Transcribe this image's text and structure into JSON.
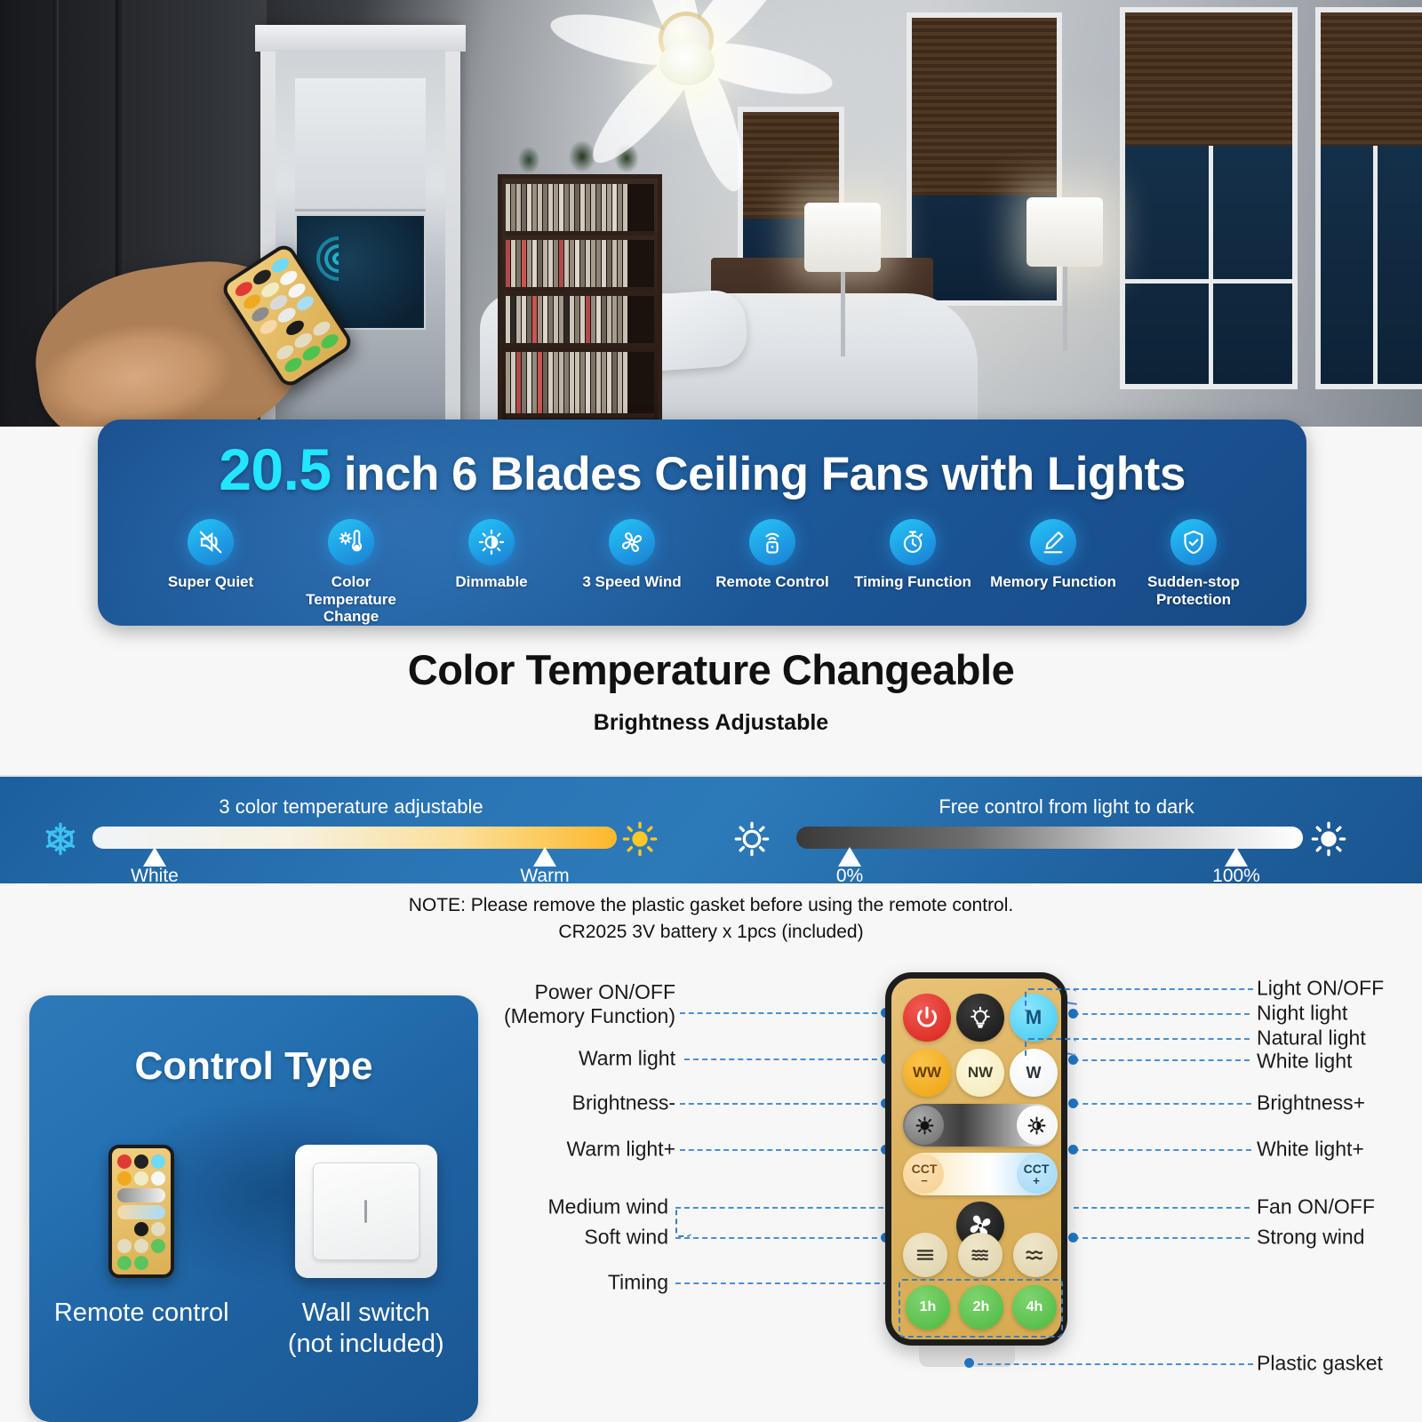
{
  "hero": {
    "alt": "bedroom-with-ceiling-fan-and-hand-holding-remote"
  },
  "banner": {
    "number": "20.5",
    "title_rest": "inch 6 Blades Ceiling Fans with Lights",
    "features": [
      {
        "label": "Super Quiet",
        "icon": "mute-speaker-icon"
      },
      {
        "label": "Color Temperature Change",
        "icon": "thermometer-sun-icon"
      },
      {
        "label": "Dimmable",
        "icon": "half-sun-icon"
      },
      {
        "label": "3 Speed Wind",
        "icon": "fan-blades-icon"
      },
      {
        "label": "Remote Control",
        "icon": "remote-signal-icon"
      },
      {
        "label": "Timing Function",
        "icon": "stopwatch-icon"
      },
      {
        "label": "Memory Function",
        "icon": "pencil-underline-icon"
      },
      {
        "label": "Sudden-stop Protection",
        "icon": "shield-check-icon"
      }
    ],
    "accent_cyan": "#22e6ff",
    "bg_blue": "#1c5697"
  },
  "mid": {
    "title": "Color Temperature Changeable",
    "subtitle": "Brightness Adjustable"
  },
  "sliders": [
    {
      "caption": "3 color temperature adjustable",
      "left_icon": "snowflake-icon",
      "right_icon": "sun-filled-icon",
      "markers": [
        {
          "label": "White",
          "pos_pct": 18
        },
        {
          "label": "Warm",
          "pos_pct": 86
        }
      ]
    },
    {
      "caption": "Free control from light to dark",
      "left_icon": "sun-outline-icon",
      "right_icon": "sun-white-icon",
      "markers": [
        {
          "label": "0%",
          "pos_pct": 19
        },
        {
          "label": "100%",
          "pos_pct": 88
        }
      ]
    }
  ],
  "note": {
    "line1": "NOTE: Please remove the plastic gasket before using the remote control.",
    "line2": "CR2025 3V battery x 1pcs (included)"
  },
  "control_type": {
    "title": "Control Type",
    "items": [
      {
        "name": "Remote control",
        "icon": "remote-control-icon"
      },
      {
        "name": "Wall switch\n(not included)",
        "icon": "wall-switch-icon"
      }
    ]
  },
  "remote": {
    "buttons": {
      "power": "",
      "light": "",
      "memory": "M",
      "warm_white": "WW",
      "natural_white": "NW",
      "white": "W",
      "brightness_down": "",
      "brightness_up": "",
      "cct_minus_top": "CCT",
      "cct_minus_sign": "−",
      "cct_plus_top": "CCT",
      "cct_plus_sign": "+",
      "fan": "",
      "wind_strong": "",
      "wind_soft": "",
      "wind_medium": "",
      "timer_1h": "1h",
      "timer_2h": "2h",
      "timer_4h": "4h"
    },
    "labels_left": [
      "Power ON/OFF\n(Memory Function)",
      "Warm light",
      "Brightness-",
      "Warm light+",
      "Medium wind",
      "Soft wind",
      "Timing"
    ],
    "labels_right": [
      "Light ON/OFF",
      "Night light",
      "Natural light",
      "White light",
      "Brightness+",
      "White light+",
      "Fan ON/OFF",
      "Strong wind",
      "Plastic gasket"
    ],
    "lead_color": "#4a8fd0"
  }
}
